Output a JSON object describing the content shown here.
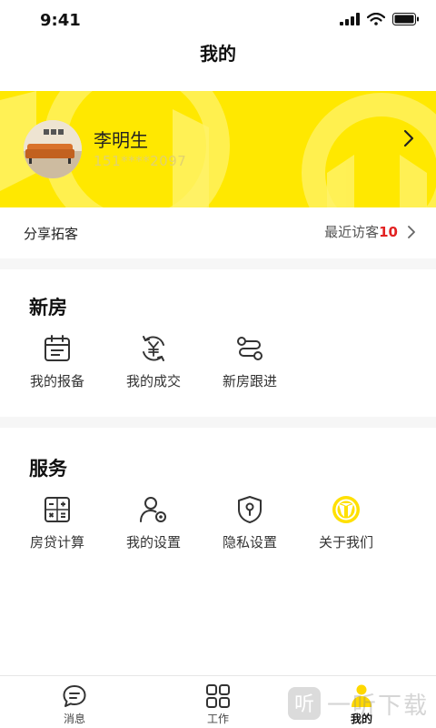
{
  "status_bar": {
    "time": "9:41"
  },
  "header": {
    "title": "我的"
  },
  "profile": {
    "name": "李明生",
    "phone": "151****2097"
  },
  "share": {
    "label": "分享拓客",
    "visitors_label": "最近访客",
    "visitors_count": "10"
  },
  "new_house": {
    "title": "新房",
    "items": [
      {
        "label": "我的报备",
        "icon": "calendar-icon"
      },
      {
        "label": "我的成交",
        "icon": "yen-cycle-icon"
      },
      {
        "label": "新房跟进",
        "icon": "follow-up-icon"
      }
    ]
  },
  "services": {
    "title": "服务",
    "items": [
      {
        "label": "房贷计算",
        "icon": "calculator-icon"
      },
      {
        "label": "我的设置",
        "icon": "user-settings-icon"
      },
      {
        "label": "隐私设置",
        "icon": "shield-lock-icon"
      },
      {
        "label": "关于我们",
        "icon": "brand-logo-icon"
      }
    ]
  },
  "tabbar": {
    "items": [
      {
        "label": "消息",
        "icon": "message-icon"
      },
      {
        "label": "工作",
        "icon": "grid-icon"
      },
      {
        "label": "我的",
        "icon": "profile-icon",
        "active": true
      }
    ]
  },
  "watermark": {
    "text": "一听下载"
  },
  "colors": {
    "brand_yellow": "#ffe800",
    "accent_red": "#e22222",
    "divider": "#f6f6f6"
  }
}
